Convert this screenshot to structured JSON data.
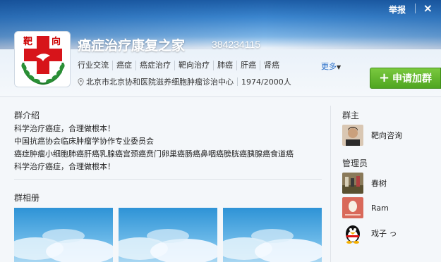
{
  "window": {
    "report": "举报",
    "close": "×"
  },
  "group": {
    "name": "癌症治疗康复之家",
    "id": "384234115",
    "logo_chars": [
      "靶",
      "向"
    ],
    "tags": [
      "行业交流",
      "癌症",
      "癌症治疗",
      "靶向治疗",
      "肺癌",
      "肝癌",
      "肾癌"
    ],
    "more": "更多",
    "location": "北京市北京协和医院滋养细胞肿瘤诊治中心",
    "members": "1974/2000人",
    "join_button": "申请加群"
  },
  "intro": {
    "title": "群介绍",
    "lines": [
      "科学治疗癌症，合理做根本！",
      "中国抗癌协会临床肿瘤学协作专业委员会",
      "癌症肿瘤小细胞肺癌肝癌乳腺癌宫颈癌贲门卵巢癌肠癌鼻咽癌膀胱癌胰腺癌食道癌",
      "科学治疗癌症，合理做根本！"
    ]
  },
  "album": {
    "title": "群相册"
  },
  "owner": {
    "title": "群主",
    "name": "靶向咨询"
  },
  "admins": {
    "title": "管理员",
    "items": [
      {
        "name": "春树",
        "icon": "photo-avatar"
      },
      {
        "name": "Ram",
        "icon": "egg-avatar"
      },
      {
        "name": "戏子 っ",
        "icon": "penguin-avatar"
      }
    ]
  },
  "colors": {
    "join": "#4fa520",
    "header_top": "#1d5da6",
    "link": "#2a6fc9"
  }
}
